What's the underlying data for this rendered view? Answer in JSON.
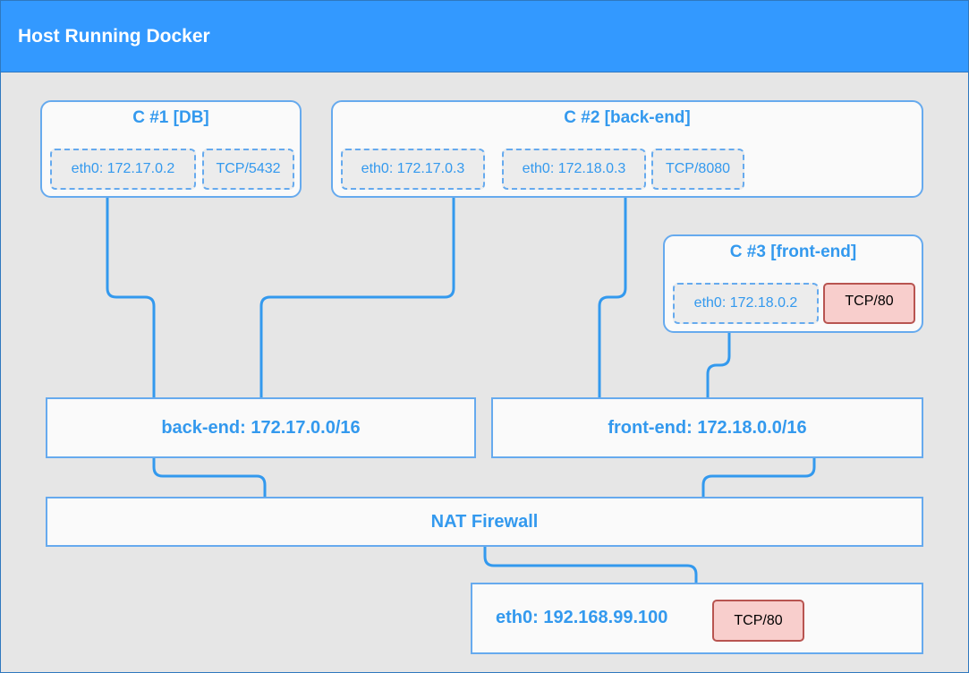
{
  "header": {
    "title": "Host Running Docker"
  },
  "containers": [
    {
      "title": "C #1 [DB]",
      "interfaces": [
        "eth0: 172.17.0.2"
      ],
      "ports": [
        "TCP/5432"
      ]
    },
    {
      "title": "C #2 [back-end]",
      "interfaces": [
        "eth0: 172.17.0.3",
        "eth0: 172.18.0.3"
      ],
      "ports": [
        "TCP/8080"
      ]
    },
    {
      "title": "C #3 [front-end]",
      "interfaces": [
        "eth0: 172.18.0.2"
      ],
      "ports": [
        "TCP/80"
      ]
    }
  ],
  "networks": {
    "back_end": "back-end: 172.17.0.0/16",
    "front_end": "front-end: 172.18.0.0/16"
  },
  "nat": "NAT Firewall",
  "host_interface": {
    "label": "eth0: 192.168.99.100",
    "port": "TCP/80"
  },
  "colors": {
    "header": "#3399ff",
    "accent": "#3399ee",
    "border": "#66aaee",
    "published_port_fill": "#f8cecc",
    "published_port_border": "#b85450",
    "background": "#e6e6e6"
  }
}
